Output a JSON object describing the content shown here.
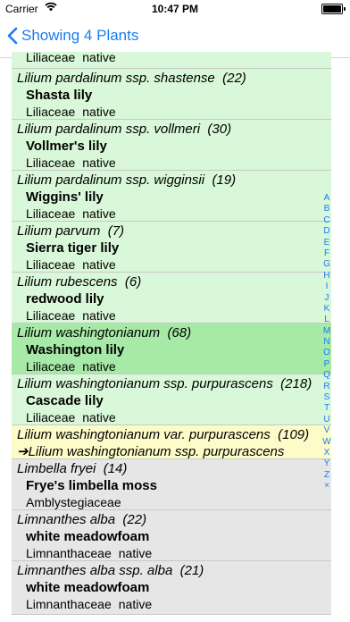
{
  "status": {
    "carrier": "Carrier",
    "time": "10:47 PM"
  },
  "nav": {
    "back_label": "Showing 4 Plants"
  },
  "rows": [
    {
      "family": "Liliaceae",
      "status": "native"
    },
    {
      "sci": "Lilium pardalinum ssp. shastense",
      "count": "(22)",
      "common": "Shasta lily",
      "family": "Liliaceae",
      "status": "native"
    },
    {
      "sci": "Lilium pardalinum ssp. vollmeri",
      "count": "(30)",
      "common": "Vollmer's lily",
      "family": "Liliaceae",
      "status": "native"
    },
    {
      "sci": "Lilium pardalinum ssp. wigginsii",
      "count": "(19)",
      "common": "Wiggins' lily",
      "family": "Liliaceae",
      "status": "native"
    },
    {
      "sci": "Lilium parvum",
      "count": "(7)",
      "common": "Sierra tiger lily",
      "family": "Liliaceae",
      "status": "native"
    },
    {
      "sci": "Lilium rubescens",
      "count": "(6)",
      "common": "redwood lily",
      "family": "Liliaceae",
      "status": "native"
    },
    {
      "sci": "Lilium washingtonianum",
      "count": "(68)",
      "common": "Washington lily",
      "family": "Liliaceae",
      "status": "native"
    },
    {
      "sci": "Lilium washingtonianum ssp. purpurascens",
      "count": "(218)",
      "common": "Cascade lily",
      "family": "Liliaceae",
      "status": "native"
    },
    {
      "sci": "Lilium washingtonianum var. purpurascens",
      "count": "(109)",
      "redirect": "➔Lilium washingtonianum ssp. purpurascens"
    },
    {
      "sci": "Limbella fryei",
      "count": "(14)",
      "common": "Frye's limbella moss",
      "family": "Amblystegiaceae"
    },
    {
      "sci": "Limnanthes alba",
      "count": "(22)",
      "common": "white meadowfoam",
      "family": "Limnanthaceae",
      "status": "native"
    },
    {
      "sci": "Limnanthes alba ssp. alba",
      "count": "(21)",
      "common": "white meadowfoam",
      "family": "Limnanthaceae",
      "status": "native"
    }
  ],
  "index": [
    "A",
    "B",
    "C",
    "D",
    "E",
    "F",
    "G",
    "H",
    "I",
    "J",
    "K",
    "L",
    "M",
    "N",
    "O",
    "P",
    "Q",
    "R",
    "S",
    "T",
    "U",
    "V",
    "W",
    "X",
    "Y",
    "Z",
    "×"
  ],
  "colors": {
    "accent": "#1a7cf4",
    "green_row": "#d9f7d9",
    "selected_row": "#a7e9a7",
    "yellow_row": "#fdfbc8",
    "gray_row": "#e6e6e6"
  }
}
